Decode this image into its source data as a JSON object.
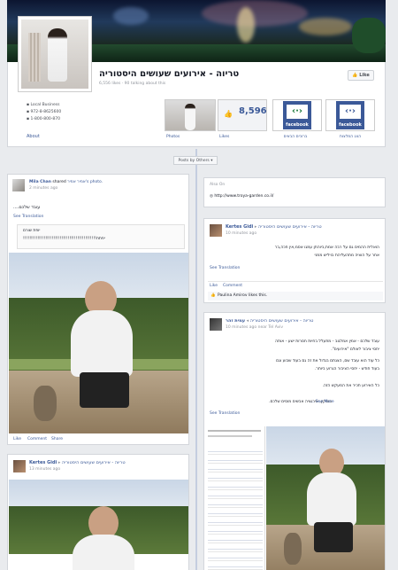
{
  "page": {
    "title": "טריוה - אירועים שעושים היסטוריה",
    "stats": "6,556 likes · 90 talking about this",
    "like_button": "Like",
    "info": {
      "category": "Local Business",
      "phone1": "972-8-8625600",
      "phone2": "1-800-800-870"
    },
    "about": "About",
    "tiles": {
      "photos": "Photos",
      "likes": "Likes",
      "likes_count": "8,596",
      "fb1_label": "ברוכים הבאים",
      "fb2_label": "הצג המלצות",
      "fb_word": "facebook"
    },
    "posts_by": "Posts by Others ▾"
  },
  "post_mila": {
    "author": "Mila Chan",
    "shared_text": "shared",
    "shared_src": "אמיר אמיר's",
    "photo_word": "photo.",
    "time": "2 minutes ago",
    "body": "עובד שלכם....",
    "see_translation": "See Translation",
    "quote1": "יופת שורם",
    "quote2": "יפתח!!!!!!!!!!!!!!!!!!!!!!!!!!!!!!!!!!!!!!!!!!!!!!",
    "actions": [
      "Like",
      "Comment",
      "Share"
    ]
  },
  "post_kertes1": {
    "author": "Kertes Gidi",
    "page": "טריוה - אירועים שעושים היסטוריה",
    "time": "13 minutes ago",
    "actions": [
      "Like",
      "Comment"
    ]
  },
  "also_on": {
    "title": "Also On",
    "url": "http://www.troya-garden.co.il/"
  },
  "post_kertes2": {
    "author": "Kertes Gidi",
    "page": "טריוה - אירועים שעושים היסטוריה",
    "time": "10 minutes ago",
    "line1": "הואלית ההמים גם על רבה אמת,ביוהתן עמגו אסמ,אין חכה,בר",
    "line2": "אחר על הוציה מתהעליהת בויליש ממני",
    "see_translation": "See Translation",
    "actions": [
      "Like",
      "Comment"
    ],
    "likes_text": "Paulina Amirov likes this."
  },
  "post_amir": {
    "author": "עמית זהר",
    "page": "טריוה - אירועים שעושים היסטוריה",
    "time": "10 minutes ago near Tel Aviv",
    "line1": "עובד שלכם - אמין אמלגוב - מתעלל בחיות חסרות ישע - אותה",
    "line2": "יחסי ציבור לאולם \"אירועים\".",
    "line3": "כל עוד הוא עובד שם, הצגתם בגדול את זה גם בעוד שבוע וגם",
    "line4": "בעוד חודש - יחסי הציבור הגרוע ביותר.",
    "line5": "כל האירוע תכיר את המעקש הזה.",
    "line6": "בוסקין, אירגציה אבשים מוסים שלכם.",
    "see_more": "... See More",
    "see_translation": "See Translation"
  }
}
